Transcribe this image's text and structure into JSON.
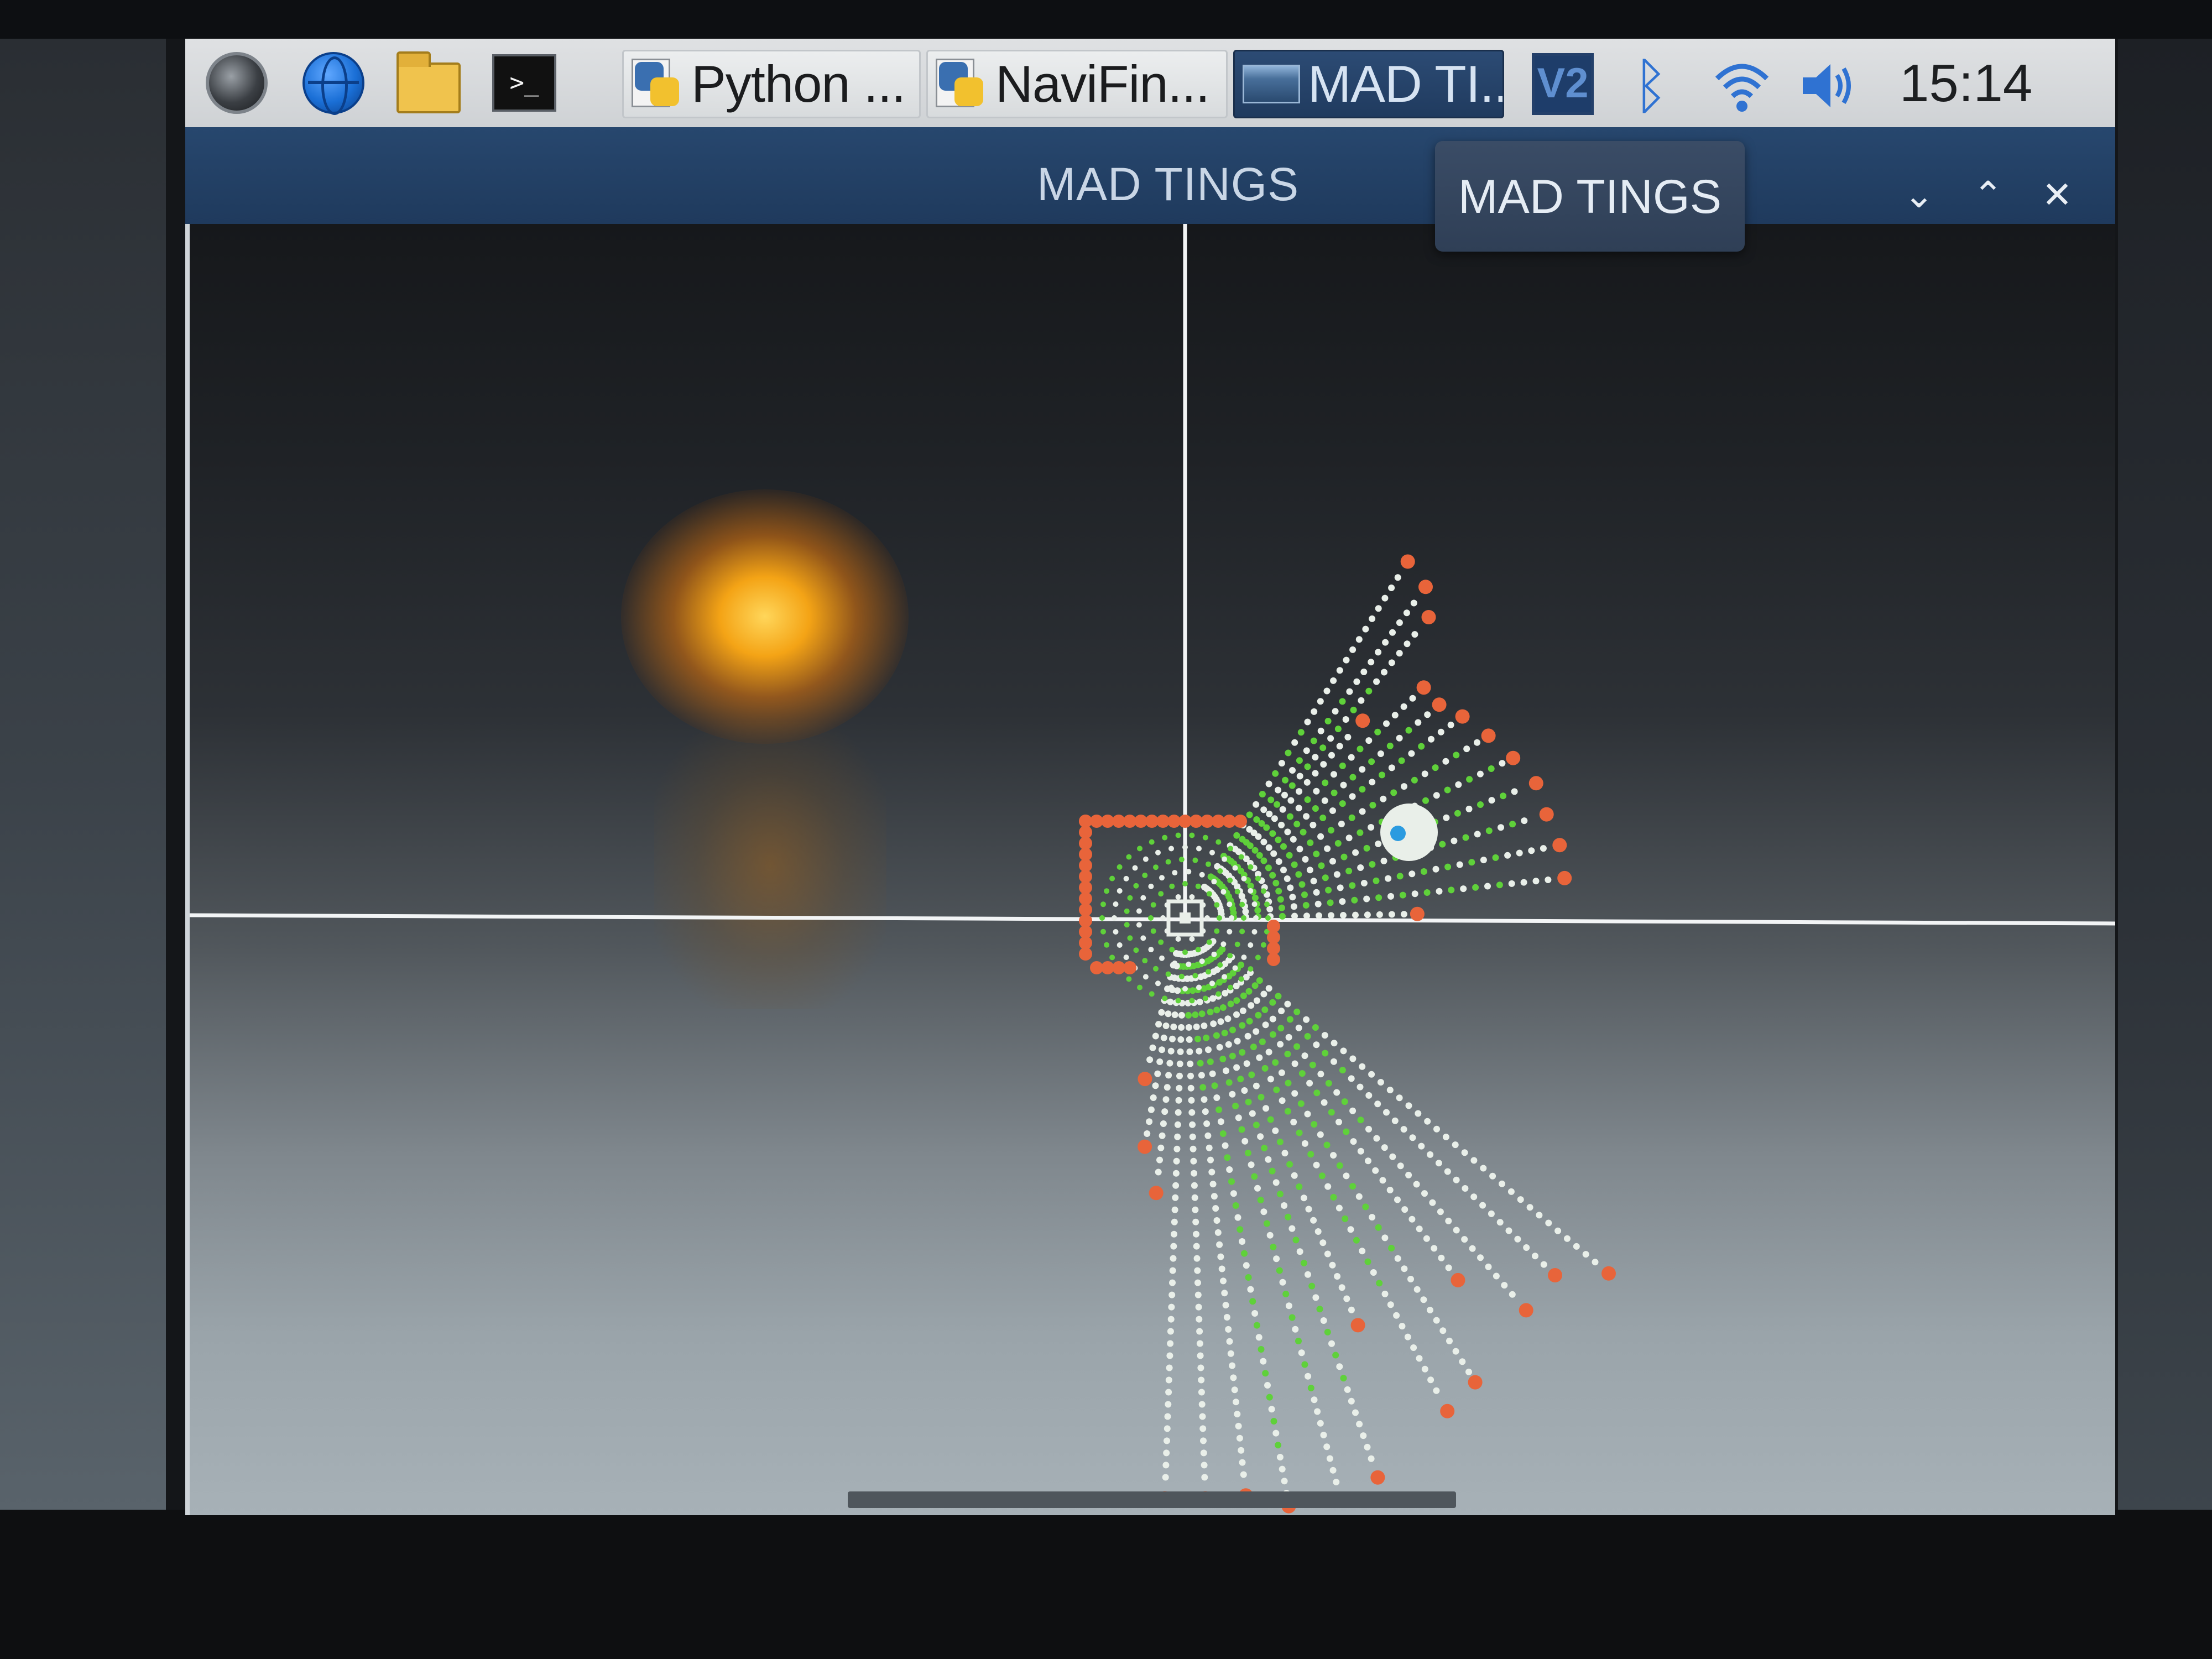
{
  "taskbar": {
    "icons": [
      "raspberry-menu-icon",
      "web-browser-icon",
      "file-manager-icon",
      "terminal-icon"
    ],
    "terminal_glyph": ">_",
    "tasks": [
      {
        "label": "Python ...",
        "icon": "python-icon"
      },
      {
        "label": "NaviFin...",
        "icon": "python-icon"
      },
      {
        "label": "MAD TI...",
        "icon": "window-icon"
      }
    ],
    "tray": {
      "vnc_label": "V2",
      "bluetooth_glyph": "ᛒ",
      "icons": [
        "vnc-icon",
        "bluetooth-icon",
        "wifi-icon",
        "volume-icon"
      ]
    },
    "clock": "15:14"
  },
  "window": {
    "title": "MAD TINGS",
    "tooltip": "MAD TINGS",
    "controls": {
      "minimize": "⌄",
      "maximize": "⌃",
      "close": "✕"
    }
  },
  "colors": {
    "lidar_hit": "#e8643a",
    "lidar_ray": "#e9efe9",
    "lidar_free": "#5fd13a",
    "axis_line": "#f2f4f5",
    "robot_marker": "#2b9be0",
    "titlebar": "#23436a"
  }
}
